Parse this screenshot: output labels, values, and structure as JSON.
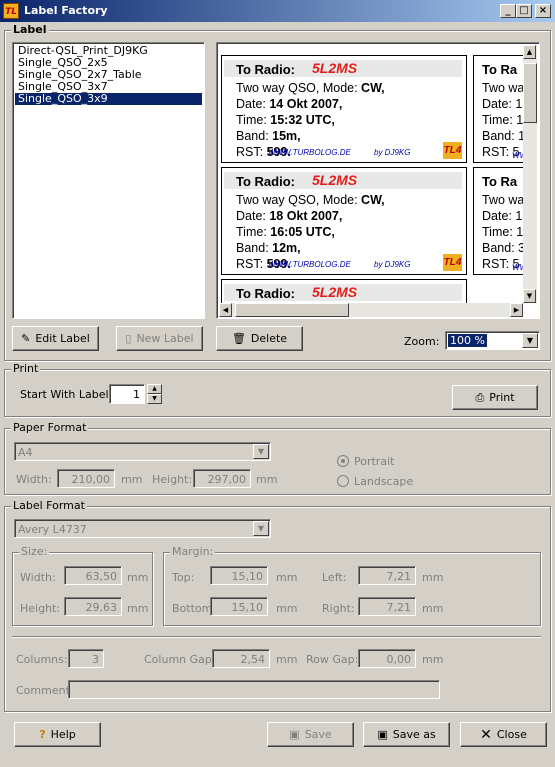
{
  "window": {
    "title": "Label Factory",
    "min": "_",
    "max": "□",
    "close": "×"
  },
  "label_group": {
    "title": "Label",
    "items": [
      "Direct-QSL_Print_DJ9KG",
      "Single_QSO_2x5",
      "Single_QSO_2x7_Table",
      "Single_QSO_3x7",
      "Single_QSO_3x9"
    ],
    "selected_index": 4
  },
  "preview": {
    "cards": [
      {
        "to_label": "To Radio:",
        "callsign": "5L2MS",
        "line1": "Two way QSO, Mode: ",
        "mode": "CW,",
        "date_label": "Date: ",
        "date": "14 Okt 2007,",
        "time_label": "Time: ",
        "time": "15:32 UTC,",
        "band_label": "Band: ",
        "band": "15m,",
        "rst_label": "RST: ",
        "rst": "599.",
        "url": "WWW.TURBOLOG.DE",
        "by": "by DJ9KG",
        "logo": "TL4"
      },
      {
        "to_label": "To Radio:",
        "callsign": "5L2MS",
        "line1": "Two way QSO, Mode: ",
        "mode": "CW,",
        "date_label": "Date: ",
        "date": "18 Okt 2007,",
        "time_label": "Time: ",
        "time": "16:05 UTC,",
        "band_label": "Band: ",
        "band": "12m,",
        "rst_label": "RST: ",
        "rst": "599.",
        "url": "WWW.TURBOLOG.DE",
        "by": "by DJ9KG",
        "logo": "TL4"
      },
      {
        "to_label": "To Radio:",
        "callsign": "5L2MS"
      }
    ],
    "right_col": [
      {
        "to": "To Ra",
        "l1": "Two wa",
        "l2": "Date: 1",
        "l3": "Time: 1",
        "l4": "Band: 1",
        "l5": "RST: 5",
        "foot": "WW"
      },
      {
        "to": "To Ra",
        "l1": "Two wa",
        "l2": "Date: 1",
        "l3": "Time: 1",
        "l4": "Band: 3",
        "l5": "RST: 5",
        "foot": "WW"
      }
    ]
  },
  "buttons": {
    "edit_label": "Edit Label",
    "new_label": "New Label",
    "delete": "Delete",
    "print": "Print",
    "help": "Help",
    "save": "Save",
    "save_as": "Save as",
    "close": "Close"
  },
  "zoom": {
    "label": "Zoom:",
    "value": "100 %"
  },
  "print_group": {
    "title": "Print",
    "start_label": "Start With Label:",
    "start_value": "1"
  },
  "paper_group": {
    "title": "Paper Format",
    "format": "A4",
    "width_label": "Width:",
    "width": "210,00",
    "height_label": "Height:",
    "height": "297,00",
    "unit": "mm",
    "portrait": "Portrait",
    "landscape": "Landscape"
  },
  "label_format": {
    "title": "Label Format",
    "format": "Avery L4737",
    "size_title": "Size:",
    "width_label": "Width:",
    "width": "63,50",
    "height_label": "Height:",
    "height": "29,63",
    "margin_title": "Margin:",
    "top_label": "Top:",
    "top": "15,10",
    "bottom_label": "Bottom:",
    "bottom": "15,10",
    "left_label": "Left:",
    "left": "7,21",
    "right_label": "Right:",
    "right": "7,21",
    "columns_label": "Columns:",
    "columns": "3",
    "colgap_label": "Column Gap:",
    "colgap": "2,54",
    "rowgap_label": "Row Gap:",
    "rowgap": "0,00",
    "comment_label": "Comment:",
    "comment": "",
    "unit": "mm"
  }
}
